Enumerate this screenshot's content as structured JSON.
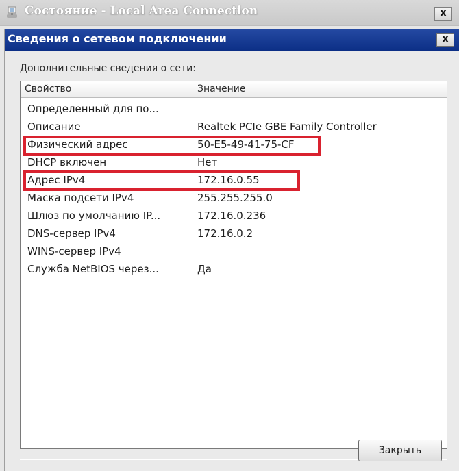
{
  "back_window": {
    "title": "Состояние - Local Area Connection",
    "close_label": "x"
  },
  "dialog": {
    "title": "Сведения о сетевом подключении",
    "close_label": "x",
    "group_label": "Дополнительные сведения о сети:",
    "columns": {
      "property": "Свойство",
      "value": "Значение"
    },
    "rows": [
      {
        "property": "Определенный для по...",
        "value": ""
      },
      {
        "property": "Описание",
        "value": "Realtek PCIe GBE Family Controller"
      },
      {
        "property": "Физический адрес",
        "value": "50-E5-49-41-75-CF"
      },
      {
        "property": "DHCP включен",
        "value": "Нет"
      },
      {
        "property": "Адрес IPv4",
        "value": "172.16.0.55"
      },
      {
        "property": "Маска подсети IPv4",
        "value": "255.255.255.0"
      },
      {
        "property": "Шлюз по умолчанию IP...",
        "value": "172.16.0.236"
      },
      {
        "property": "DNS-сервер IPv4",
        "value": "172.16.0.2"
      },
      {
        "property": "WINS-сервер IPv4",
        "value": ""
      },
      {
        "property": "Служба NetBIOS через...",
        "value": "Да"
      }
    ],
    "close_button_label": "Закрыть"
  },
  "colors": {
    "titlebar_active": "#0c2f86",
    "highlight": "#d9222f"
  },
  "icons": {
    "back_window_icon": "network-connection-icon"
  }
}
